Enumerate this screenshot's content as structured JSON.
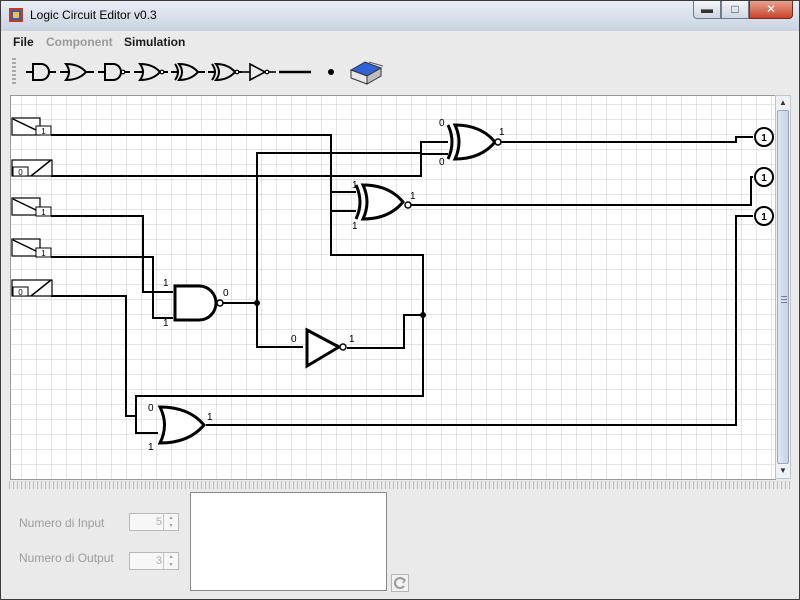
{
  "window": {
    "title": "Logic Circuit Editor v0.3"
  },
  "menu": {
    "items": [
      {
        "label": "File",
        "enabled": true
      },
      {
        "label": "Component",
        "enabled": false
      },
      {
        "label": "Simulation",
        "enabled": true
      }
    ]
  },
  "toolbar": {
    "tools": [
      "and-gate-icon",
      "or-gate-icon",
      "nand-gate-icon",
      "nor-gate-icon",
      "xor-gate-icon",
      "xnor-gate-icon",
      "not-gate-icon",
      "wire-icon",
      "node-icon",
      "eraser-icon"
    ]
  },
  "circuit": {
    "inputs": [
      {
        "value": "1"
      },
      {
        "value": "0"
      },
      {
        "value": "1"
      },
      {
        "value": "1"
      },
      {
        "value": "0"
      }
    ],
    "outputs": [
      {
        "value": "1"
      },
      {
        "value": "1"
      },
      {
        "value": "1"
      }
    ],
    "gates": {
      "xnor": {
        "in_top": "0",
        "in_bottom": "0",
        "out": "1"
      },
      "xor": {
        "in_top": "1",
        "in_bottom": "1",
        "out": "1"
      },
      "and": {
        "in_top": "1",
        "in_bottom": "1",
        "out": "0"
      },
      "not": {
        "in": "0",
        "out": "1"
      },
      "or": {
        "in_top": "0",
        "in_bottom": "1",
        "out": "1"
      }
    }
  },
  "config": {
    "inputs_label": "Numero di Input",
    "inputs_value": "5",
    "outputs_label": "Numero di Output",
    "outputs_value": "3"
  }
}
